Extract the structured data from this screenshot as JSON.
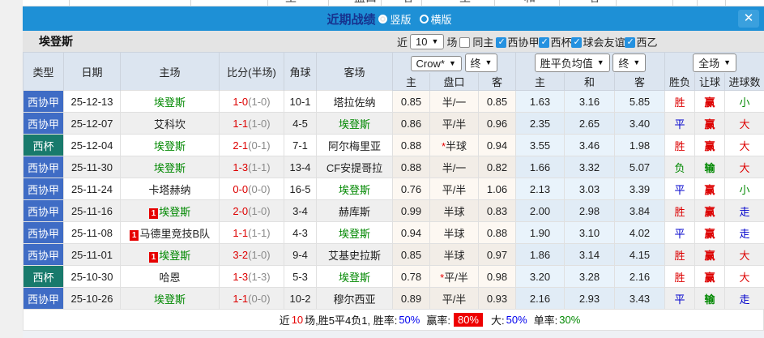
{
  "colors": {
    "titlebar_blue": "#1e90d6",
    "badge_blue": "#3f6cc5",
    "badge_teal": "#187a6c",
    "highlight_red": "#ee0000",
    "green_team": "#008800"
  },
  "background_strip": {
    "labels": [
      "主",
      "盘口",
      "客",
      "主",
      "和",
      "客"
    ]
  },
  "modal": {
    "title": "近期战绩",
    "vertical_label": "竖版",
    "horizontal_label": "横版",
    "close_label": "✕"
  },
  "filter": {
    "team": "埃登斯",
    "recent_label": "近",
    "recent_count": "10",
    "games_label": "场",
    "same_home_label": "同主",
    "leagues": [
      "西协甲",
      "西杯",
      "球会友谊",
      "西乙"
    ]
  },
  "table": {
    "dropdowns": {
      "asian_company": "Crow*",
      "asian_time": "终",
      "euro_company": "胜平负均值",
      "euro_time": "终",
      "scope": "全场"
    },
    "columns": [
      "类型",
      "日期",
      "主场",
      "比分(半场)",
      "角球",
      "客场"
    ],
    "sub_columns": [
      "主",
      "盘口",
      "客",
      "主",
      "和",
      "客",
      "胜负",
      "让球",
      "进球数"
    ],
    "rows": [
      {
        "type": "西协甲",
        "type_color": "blue",
        "date": "25-12-13",
        "home": {
          "name": "埃登斯",
          "green": true,
          "badge": ""
        },
        "score": "1-0",
        "half": "(1-0)",
        "corner": "10-1",
        "away": {
          "name": "塔拉佐纳",
          "green": false
        },
        "asian": {
          "home": "0.85",
          "star": "",
          "handicap": "半/一",
          "away": "0.85"
        },
        "euro": {
          "home": "1.63",
          "draw": "3.16",
          "away": "5.85"
        },
        "result": {
          "text": "胜",
          "color": "red"
        },
        "handicap_result": {
          "text": "赢",
          "color": "red"
        },
        "goals": {
          "text": "小",
          "color": "green"
        }
      },
      {
        "type": "西协甲",
        "type_color": "blue",
        "date": "25-12-07",
        "home": {
          "name": "艾科坎",
          "green": false,
          "badge": ""
        },
        "score": "1-1",
        "half": "(1-0)",
        "corner": "4-5",
        "away": {
          "name": "埃登斯",
          "green": true
        },
        "asian": {
          "home": "0.86",
          "star": "",
          "handicap": "平/半",
          "away": "0.96"
        },
        "euro": {
          "home": "2.35",
          "draw": "2.65",
          "away": "3.40"
        },
        "result": {
          "text": "平",
          "color": "blue"
        },
        "handicap_result": {
          "text": "赢",
          "color": "red"
        },
        "goals": {
          "text": "大",
          "color": "red"
        }
      },
      {
        "type": "西杯",
        "type_color": "teal",
        "date": "25-12-04",
        "home": {
          "name": "埃登斯",
          "green": true,
          "badge": ""
        },
        "score": "2-1",
        "half": "(0-1)",
        "corner": "7-1",
        "away": {
          "name": "阿尔梅里亚",
          "green": false
        },
        "asian": {
          "home": "0.88",
          "star": "*",
          "handicap": "半球",
          "away": "0.94"
        },
        "euro": {
          "home": "3.55",
          "draw": "3.46",
          "away": "1.98"
        },
        "result": {
          "text": "胜",
          "color": "red"
        },
        "handicap_result": {
          "text": "赢",
          "color": "red"
        },
        "goals": {
          "text": "大",
          "color": "red"
        }
      },
      {
        "type": "西协甲",
        "type_color": "blue",
        "date": "25-11-30",
        "home": {
          "name": "埃登斯",
          "green": true,
          "badge": ""
        },
        "score": "1-3",
        "half": "(1-1)",
        "corner": "13-4",
        "away": {
          "name": "CF安提哥拉",
          "green": false
        },
        "asian": {
          "home": "0.88",
          "star": "",
          "handicap": "半/一",
          "away": "0.82"
        },
        "euro": {
          "home": "1.66",
          "draw": "3.32",
          "away": "5.07"
        },
        "result": {
          "text": "负",
          "color": "green"
        },
        "handicap_result": {
          "text": "输",
          "color": "green"
        },
        "goals": {
          "text": "大",
          "color": "red"
        }
      },
      {
        "type": "西协甲",
        "type_color": "blue",
        "date": "25-11-24",
        "home": {
          "name": "卡塔赫纳",
          "green": false,
          "badge": ""
        },
        "score": "0-0",
        "half": "(0-0)",
        "corner": "16-5",
        "away": {
          "name": "埃登斯",
          "green": true
        },
        "asian": {
          "home": "0.76",
          "star": "",
          "handicap": "平/半",
          "away": "1.06"
        },
        "euro": {
          "home": "2.13",
          "draw": "3.03",
          "away": "3.39"
        },
        "result": {
          "text": "平",
          "color": "blue"
        },
        "handicap_result": {
          "text": "赢",
          "color": "red"
        },
        "goals": {
          "text": "小",
          "color": "green"
        }
      },
      {
        "type": "西协甲",
        "type_color": "blue",
        "date": "25-11-16",
        "home": {
          "name": "埃登斯",
          "green": true,
          "badge": "1"
        },
        "score": "2-0",
        "half": "(1-0)",
        "corner": "3-4",
        "away": {
          "name": "赫库斯",
          "green": false
        },
        "asian": {
          "home": "0.99",
          "star": "",
          "handicap": "半球",
          "away": "0.83"
        },
        "euro": {
          "home": "2.00",
          "draw": "2.98",
          "away": "3.84"
        },
        "result": {
          "text": "胜",
          "color": "red"
        },
        "handicap_result": {
          "text": "赢",
          "color": "red"
        },
        "goals": {
          "text": "走",
          "color": "blue"
        }
      },
      {
        "type": "西协甲",
        "type_color": "blue",
        "date": "25-11-08",
        "home": {
          "name": "马德里竞技B队",
          "green": false,
          "badge": "1"
        },
        "score": "1-1",
        "half": "(1-1)",
        "corner": "4-3",
        "away": {
          "name": "埃登斯",
          "green": true
        },
        "asian": {
          "home": "0.94",
          "star": "",
          "handicap": "半球",
          "away": "0.88"
        },
        "euro": {
          "home": "1.90",
          "draw": "3.10",
          "away": "4.02"
        },
        "result": {
          "text": "平",
          "color": "blue"
        },
        "handicap_result": {
          "text": "赢",
          "color": "red"
        },
        "goals": {
          "text": "走",
          "color": "blue"
        }
      },
      {
        "type": "西协甲",
        "type_color": "blue",
        "date": "25-11-01",
        "home": {
          "name": "埃登斯",
          "green": true,
          "badge": "1"
        },
        "score": "3-2",
        "half": "(1-0)",
        "corner": "9-4",
        "away": {
          "name": "艾基史拉斯",
          "green": false
        },
        "asian": {
          "home": "0.85",
          "star": "",
          "handicap": "半球",
          "away": "0.97"
        },
        "euro": {
          "home": "1.86",
          "draw": "3.14",
          "away": "4.15"
        },
        "result": {
          "text": "胜",
          "color": "red"
        },
        "handicap_result": {
          "text": "赢",
          "color": "red"
        },
        "goals": {
          "text": "大",
          "color": "red"
        }
      },
      {
        "type": "西杯",
        "type_color": "teal",
        "date": "25-10-30",
        "home": {
          "name": "哈恩",
          "green": false,
          "badge": ""
        },
        "score": "1-3",
        "half": "(1-3)",
        "corner": "5-3",
        "away": {
          "name": "埃登斯",
          "green": true
        },
        "asian": {
          "home": "0.78",
          "star": "*",
          "handicap": "平/半",
          "away": "0.98"
        },
        "euro": {
          "home": "3.20",
          "draw": "3.28",
          "away": "2.16"
        },
        "result": {
          "text": "胜",
          "color": "red"
        },
        "handicap_result": {
          "text": "赢",
          "color": "red"
        },
        "goals": {
          "text": "大",
          "color": "red"
        }
      },
      {
        "type": "西协甲",
        "type_color": "blue",
        "date": "25-10-26",
        "home": {
          "name": "埃登斯",
          "green": true,
          "badge": ""
        },
        "score": "1-1",
        "half": "(0-0)",
        "corner": "10-2",
        "away": {
          "name": "穆尔西亚",
          "green": false
        },
        "asian": {
          "home": "0.89",
          "star": "",
          "handicap": "平/半",
          "away": "0.93"
        },
        "euro": {
          "home": "2.16",
          "draw": "2.93",
          "away": "3.43"
        },
        "result": {
          "text": "平",
          "color": "blue"
        },
        "handicap_result": {
          "text": "输",
          "color": "green"
        },
        "goals": {
          "text": "走",
          "color": "blue"
        }
      }
    ]
  },
  "summary": {
    "prefix": "近",
    "count": "10",
    "middle": "场,胜5平4负1, 胜率:",
    "win_rate": "50%",
    "handicap_label": "赢率:",
    "handicap_rate": "80%",
    "big_label": "大:",
    "big_rate": "50%",
    "single_label": "单率:",
    "single_rate": "30%"
  }
}
